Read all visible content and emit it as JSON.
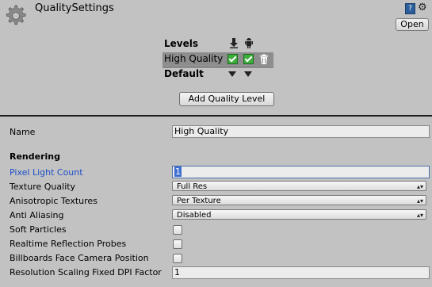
{
  "header": {
    "title": "QualitySettings",
    "open_label": "Open",
    "help_icon_label": "?",
    "settings_icon_glyph": "⚙"
  },
  "levels": {
    "header_label": "Levels",
    "standalone_icon": "download-arrow-icon",
    "android_icon": "android-icon",
    "rows": [
      {
        "name": "High Quality",
        "standalone": true,
        "android": true
      }
    ],
    "default_label": "Default",
    "add_button_label": "Add Quality Level"
  },
  "name_field": {
    "label": "Name",
    "value": "High Quality"
  },
  "rendering": {
    "section_title": "Rendering",
    "pixel_light_count": {
      "label": "Pixel Light Count",
      "value": "1"
    },
    "texture_quality": {
      "label": "Texture Quality",
      "value": "Full Res"
    },
    "anisotropic_textures": {
      "label": "Anisotropic Textures",
      "value": "Per Texture"
    },
    "anti_aliasing": {
      "label": "Anti Aliasing",
      "value": "Disabled"
    },
    "soft_particles": {
      "label": "Soft Particles",
      "checked": false
    },
    "realtime_reflection_probes": {
      "label": "Realtime Reflection Probes",
      "checked": false
    },
    "billboards_face_camera": {
      "label": "Billboards Face Camera Position",
      "checked": false
    },
    "resolution_scaling_dpi": {
      "label": "Resolution Scaling Fixed DPI Factor",
      "value": "1"
    }
  },
  "colors": {
    "background": "#c2c2c2",
    "active_label": "#1e4ec8",
    "checkbox_on": "#3cae3c"
  }
}
